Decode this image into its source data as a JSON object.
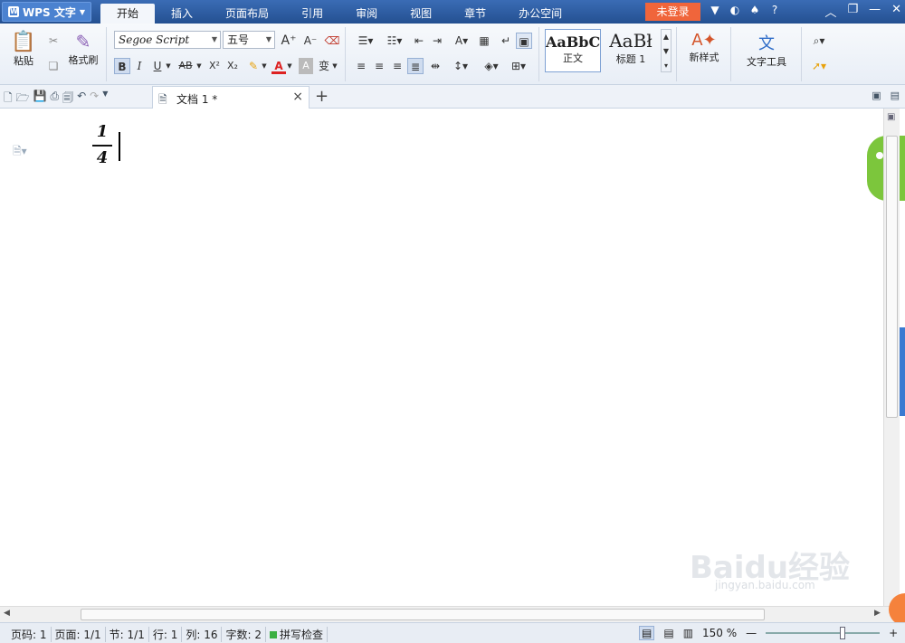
{
  "app": {
    "name": "WPS 文字",
    "menu": [
      "开始",
      "插入",
      "页面布局",
      "引用",
      "审阅",
      "视图",
      "章节",
      "办公空间"
    ],
    "active_menu": "开始",
    "login_label": "未登录",
    "help_label": "?"
  },
  "ribbon": {
    "paste_label": "粘贴",
    "format_painter_label": "格式刷",
    "font_name": "Segoe Script",
    "font_size": "五号",
    "styles": [
      {
        "preview": "AaBbC",
        "label": "正文"
      },
      {
        "preview": "AaBł",
        "label": "标题 1"
      }
    ],
    "new_style_label": "新样式",
    "text_tools_label": "文字工具",
    "bold_label": "B",
    "italic_label": "I",
    "underline_label": "U",
    "strike_label": "AB",
    "superscript_label": "X²",
    "subscript_label": "X₂",
    "font_color_label": "A",
    "char_shade_label": "A",
    "phonetic_label": "变"
  },
  "doc_tabs": {
    "active_title": "文档 1 *"
  },
  "document": {
    "fraction_numerator": "1",
    "fraction_denominator": "4"
  },
  "watermark": {
    "text": "Baidu经验",
    "sub": "jingyan.baidu.com"
  },
  "statusbar": {
    "page_code": "页码: 1",
    "page": "页面: 1/1",
    "section": "节: 1/1",
    "row": "行: 1",
    "col": "列: 16",
    "word_count": "字数: 2",
    "spell_check": "拼写检查",
    "zoom": "150 %"
  },
  "colors": {
    "titlebar": "#2b5797",
    "login": "#f0653b",
    "accent_blue": "#3b7ad1"
  }
}
